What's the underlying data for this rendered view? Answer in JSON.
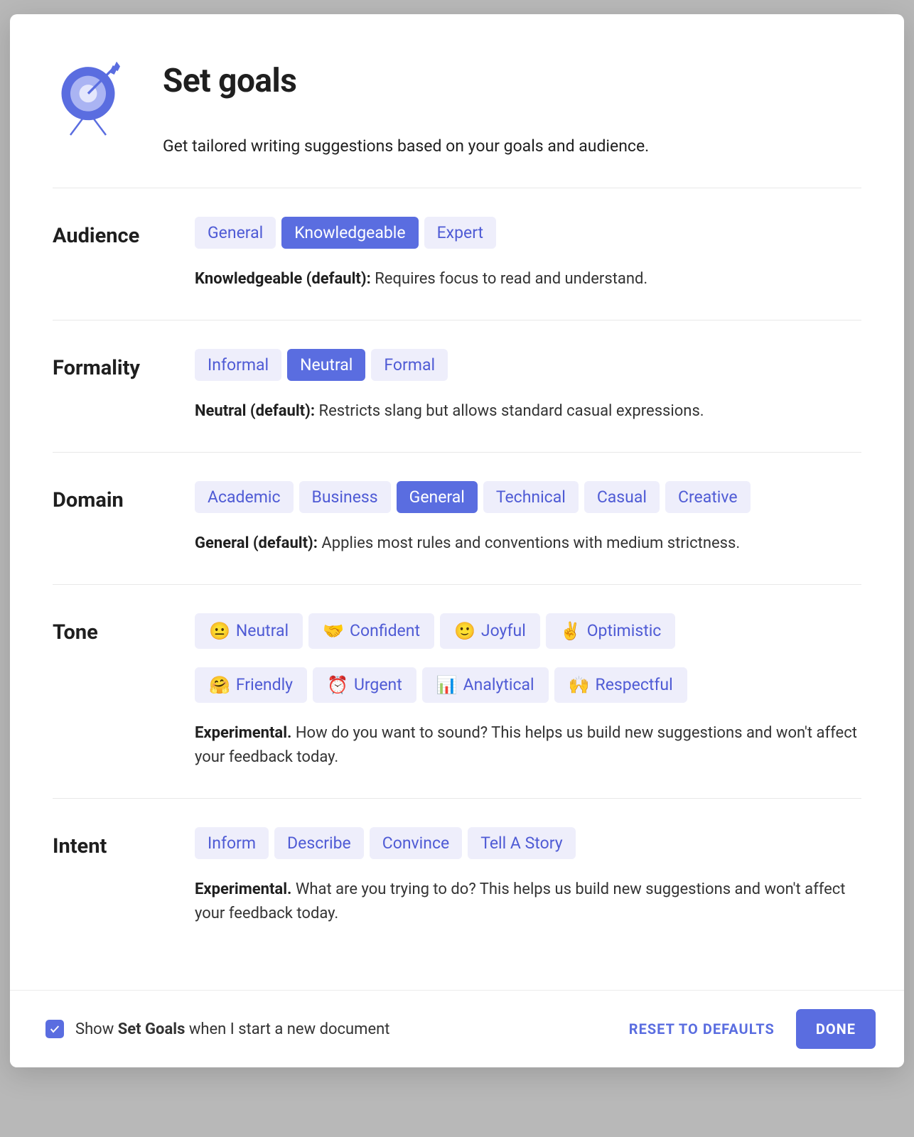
{
  "header": {
    "title": "Set goals",
    "subtitle": "Get tailored writing suggestions based on your goals and audience."
  },
  "sections": {
    "audience": {
      "label": "Audience",
      "options": [
        "General",
        "Knowledgeable",
        "Expert"
      ],
      "selected": "Knowledgeable",
      "desc_strong": "Knowledgeable (default):",
      "desc_rest": " Requires focus to read and understand."
    },
    "formality": {
      "label": "Formality",
      "options": [
        "Informal",
        "Neutral",
        "Formal"
      ],
      "selected": "Neutral",
      "desc_strong": "Neutral (default):",
      "desc_rest": " Restricts slang but allows standard casual expressions."
    },
    "domain": {
      "label": "Domain",
      "options": [
        "Academic",
        "Business",
        "General",
        "Technical",
        "Casual",
        "Creative"
      ],
      "selected": "General",
      "desc_strong": "General (default):",
      "desc_rest": " Applies most rules and conventions with medium strictness."
    },
    "tone": {
      "label": "Tone",
      "row1": [
        {
          "emoji": "😐",
          "label": "Neutral"
        },
        {
          "emoji": "🤝",
          "label": "Confident"
        },
        {
          "emoji": "🙂",
          "label": "Joyful"
        },
        {
          "emoji": "✌️",
          "label": "Optimistic"
        }
      ],
      "row2": [
        {
          "emoji": "🤗",
          "label": "Friendly"
        },
        {
          "emoji": "⏰",
          "label": "Urgent"
        },
        {
          "emoji": "📊",
          "label": "Analytical"
        },
        {
          "emoji": "🙌",
          "label": "Respectful"
        }
      ],
      "desc_strong": "Experimental.",
      "desc_rest": " How do you want to sound? This helps us build new suggestions and won't affect your feedback today."
    },
    "intent": {
      "label": "Intent",
      "options": [
        "Inform",
        "Describe",
        "Convince",
        "Tell A Story"
      ],
      "desc_strong": "Experimental.",
      "desc_rest": " What are you trying to do? This helps us build new suggestions and won't affect your feedback today."
    }
  },
  "footer": {
    "checkbox_checked": true,
    "show_pre": "Show ",
    "show_bold": "Set Goals",
    "show_post": " when I start a new document",
    "reset": "RESET TO DEFAULTS",
    "done": "DONE"
  }
}
